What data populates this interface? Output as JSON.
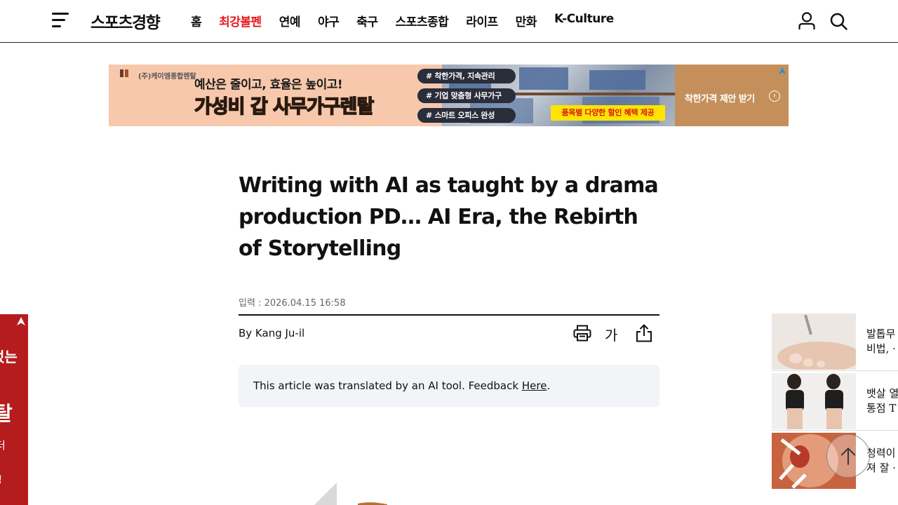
{
  "header": {
    "logo": "스포츠경향",
    "nav": [
      "홈",
      "최강볼펜",
      "연예",
      "야구",
      "축구",
      "스포츠종합",
      "라이프",
      "만화",
      "K-Culture"
    ],
    "active_nav": "최강볼펜",
    "accent_color": "#e8191f"
  },
  "top_ad": {
    "brand": "(주)케이엠종합렌탈",
    "line1": "예산은 줄이고, 효율은 높이고!",
    "line2_highlight": "가성비 갑",
    "line2_rest": "사무가구렌탈",
    "tags": [
      "# 착한가격, 지속관리",
      "# 기업 맞춤형 사무가구",
      "# 스마트 오피스 완성"
    ],
    "promo": "품목별 다양한 할인 혜택 제공",
    "cta": "착한가격 제안 받기"
  },
  "article": {
    "headline": "Writing with AI as taught by a drama production PD… AI Era, the Rebirth of Storytelling",
    "dateline": "입력 : 2026.04.15 16:58",
    "byline": "By Kang Ju-il",
    "font_tool_label": "가",
    "ai_notice_text": "This article was translated by an AI tool. Feedback ",
    "ai_notice_link": "Here",
    "ai_notice_end": "."
  },
  "left_side_ad": {
    "text1": "렀는",
    "text2": "탈",
    "text3": "터",
    "text4": "!"
  },
  "right_rail": {
    "items": [
      {
        "line1": "발톱무",
        "line2": "비법, ·"
      },
      {
        "line1": "뱃살 열",
        "line2": "통점 T"
      },
      {
        "line1": "청력이",
        "line2": "져 잘 ·"
      }
    ]
  }
}
